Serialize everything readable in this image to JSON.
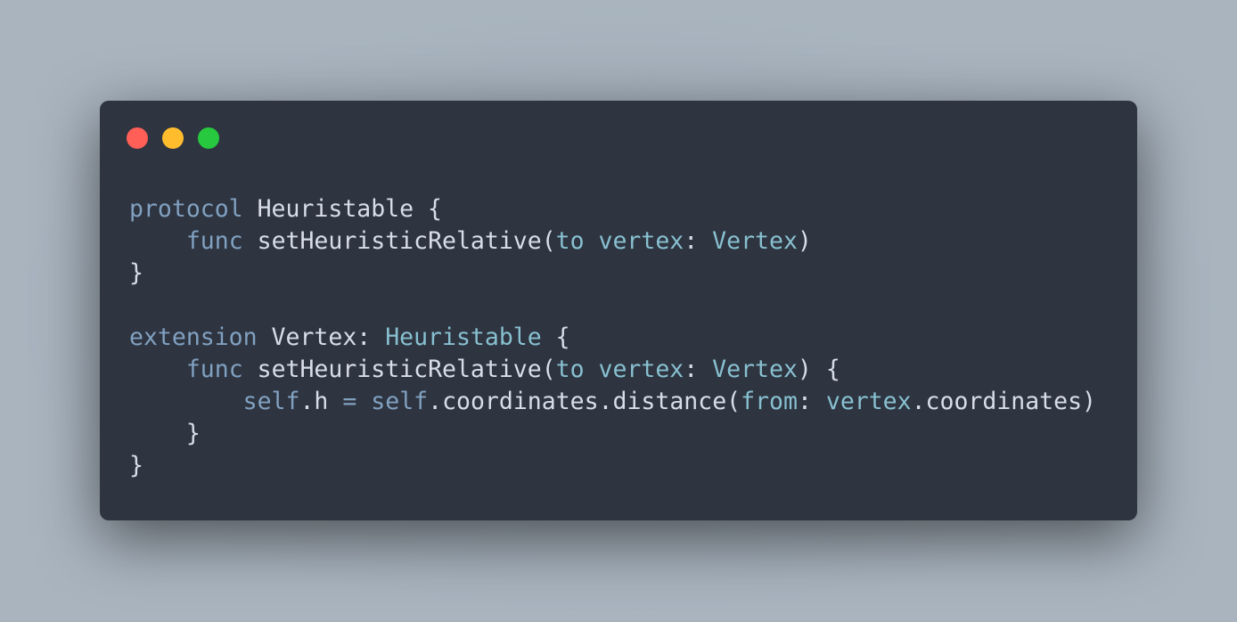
{
  "window_controls": {
    "close_color": "#ff5f56",
    "minimize_color": "#ffbd2e",
    "maximize_color": "#27c93f"
  },
  "code": {
    "language": "swift",
    "lines": [
      [
        [
          "kw",
          "protocol"
        ],
        [
          "tx",
          " Heuristable {"
        ]
      ],
      [
        [
          "tx",
          "    "
        ],
        [
          "kw",
          "func"
        ],
        [
          "tx",
          " setHeuristicRelative("
        ],
        [
          "ty",
          "to vertex"
        ],
        [
          "tx",
          ": "
        ],
        [
          "ty",
          "Vertex"
        ],
        [
          "tx",
          ")"
        ]
      ],
      [
        [
          "tx",
          "}"
        ]
      ],
      [],
      [
        [
          "kw",
          "extension"
        ],
        [
          "tx",
          " Vertex: "
        ],
        [
          "ty",
          "Heuristable"
        ],
        [
          "tx",
          " {"
        ]
      ],
      [
        [
          "tx",
          "    "
        ],
        [
          "kw",
          "func"
        ],
        [
          "tx",
          " setHeuristicRelative("
        ],
        [
          "ty",
          "to vertex"
        ],
        [
          "tx",
          ": "
        ],
        [
          "ty",
          "Vertex"
        ],
        [
          "tx",
          ") {"
        ]
      ],
      [
        [
          "tx",
          "        "
        ],
        [
          "kw",
          "self"
        ],
        [
          "tx",
          ".h "
        ],
        [
          "kw",
          "="
        ],
        [
          "tx",
          " "
        ],
        [
          "kw",
          "self"
        ],
        [
          "tx",
          ".coordinates.distance("
        ],
        [
          "ty",
          "from"
        ],
        [
          "tx",
          ": "
        ],
        [
          "ty",
          "vertex"
        ],
        [
          "tx",
          ".coordinates)"
        ]
      ],
      [
        [
          "tx",
          "    }"
        ]
      ],
      [
        [
          "tx",
          "}"
        ]
      ]
    ]
  }
}
